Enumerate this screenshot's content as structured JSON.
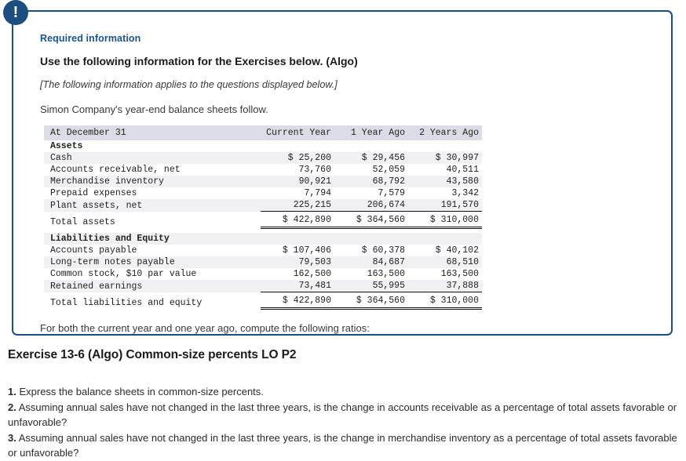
{
  "panel": {
    "alert_icon": "exclamation-icon",
    "alert_glyph": "!",
    "required_label": "Required information",
    "heading": "Use the following information for the Exercises below. (Algo)",
    "applies_note": "[The following information applies to the questions displayed below.]",
    "intro": "Simon Company's year-end balance sheets follow.",
    "closing": "For both the current year and one year ago, compute the following ratios:"
  },
  "table": {
    "columns": [
      "At December 31",
      "Current Year",
      "1 Year Ago",
      "2 Years Ago"
    ],
    "sections": [
      {
        "title": "Assets",
        "rows": [
          {
            "label": "Cash",
            "values": [
              "$ 25,200",
              "$ 29,456",
              "$ 30,997"
            ]
          },
          {
            "label": "Accounts receivable, net",
            "values": [
              "73,760",
              "52,059",
              "40,511"
            ]
          },
          {
            "label": "Merchandise inventory",
            "values": [
              "90,921",
              "68,792",
              "43,580"
            ]
          },
          {
            "label": "Prepaid expenses",
            "values": [
              "7,794",
              "7,579",
              "3,342"
            ]
          },
          {
            "label": "Plant assets, net",
            "values": [
              "225,215",
              "206,674",
              "191,570"
            ]
          }
        ],
        "total": {
          "label": "Total assets",
          "values": [
            "$ 422,890",
            "$ 364,560",
            "$ 310,000"
          ]
        }
      },
      {
        "title": "Liabilities and Equity",
        "rows": [
          {
            "label": "Accounts payable",
            "values": [
              "$ 107,406",
              "$ 60,378",
              "$ 40,102"
            ]
          },
          {
            "label": "Long-term notes payable",
            "values": [
              "79,503",
              "84,687",
              "68,510"
            ]
          },
          {
            "label": "Common stock, $10 par value",
            "values": [
              "162,500",
              "163,500",
              "163,500"
            ]
          },
          {
            "label": "Retained earnings",
            "values": [
              "73,481",
              "55,995",
              "37,888"
            ]
          }
        ],
        "total": {
          "label": "Total liabilities and equity",
          "values": [
            "$ 422,890",
            "$ 364,560",
            "$ 310,000"
          ]
        }
      }
    ]
  },
  "exercise": {
    "title": "Exercise 13-6 (Algo) Common-size percents LO P2",
    "questions": [
      {
        "number": "1.",
        "text": "Express the balance sheets in common-size percents."
      },
      {
        "number": "2.",
        "text": "Assuming annual sales have not changed in the last three years, is the change in accounts receivable as a percentage of total assets favorable or unfavorable?"
      },
      {
        "number": "3.",
        "text": "Assuming annual sales have not changed in the last three years, is the change in merchandise inventory as a percentage of total assets favorable or unfavorable?"
      }
    ]
  },
  "colors": {
    "panel_border": "#1c4e80",
    "badge_bg": "#1c4e80",
    "required_label": "#1a5490",
    "table_header_bg": "#dcdce6",
    "table_stripe_bg": "#f1f1f4"
  }
}
